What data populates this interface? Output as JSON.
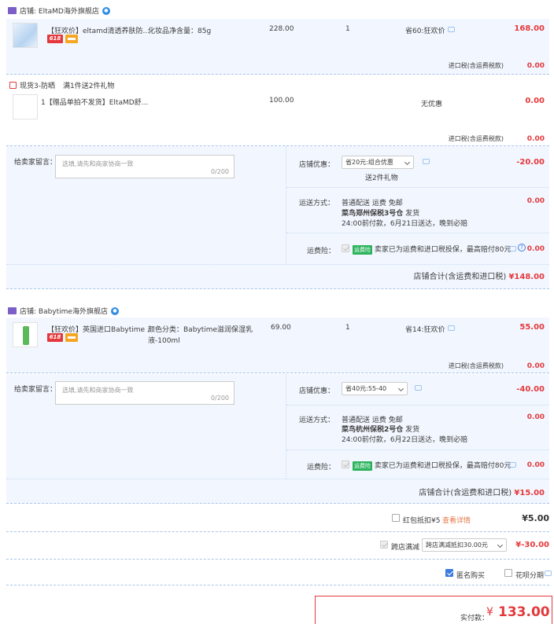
{
  "store1": {
    "name": "店铺: EltaMD海外旗舰店",
    "item": {
      "title": "【狂欢价】eltamd清透养肤防...",
      "tag618": "618",
      "sku": "化妆品净含量：85g",
      "price": "228.00",
      "qty": "1",
      "discount": "省60:狂欢价",
      "subtotal": "168.00"
    },
    "tax1": "进口税(含运费税款)",
    "tax1_val": "0.00",
    "gift_header": "现货3-防晒",
    "gift_rule": "满1件送2件礼物",
    "gift_item": {
      "title": "1【赠品单拍不发货】EltaMD舒...",
      "price": "100.00",
      "discount": "无优惠",
      "subtotal": "0.00"
    },
    "tax2": "进口税(含运费税款)",
    "tax2_val": "0.00",
    "msg_label": "给卖家留言：",
    "msg_placeholder": "选填,请先和商家协商一致",
    "msg_count": "0/200",
    "coupon_label": "店铺优惠：",
    "coupon_value": "省20元:组合优惠",
    "coupon_note": "送2件礼物",
    "coupon_amount": "-20.00",
    "ship_label": "运送方式：",
    "ship_line1": "普通配送 运费 免邮",
    "ship_line2a": "菜鸟郑州保税3号仓",
    "ship_line2b": "发货",
    "ship_line3": "24:00前付款，6月21日送达，晚到必赔",
    "ship_amount": "0.00",
    "ins_label": "运费险：",
    "ins_badge": "运费险",
    "ins_text": "卖家已为运费和进口税投保，最高赔付80元",
    "ins_amount": "0.00",
    "total_label": "店铺合计(含运费和进口税)",
    "total_value": "¥148.00"
  },
  "store2": {
    "name": "店铺: Babytime海外旗舰店",
    "item": {
      "title": "【狂欢价】英国进口Babytime ...",
      "tag618": "618",
      "sku_line1": "颜色分类：Babytime滋润保湿乳",
      "sku_line2": "液-100ml",
      "price": "69.00",
      "qty": "1",
      "discount": "省14:狂欢价",
      "subtotal": "55.00"
    },
    "tax": "进口税(含运费税款)",
    "tax_val": "0.00",
    "msg_label": "给卖家留言：",
    "msg_placeholder": "选填,请先和商家协商一致",
    "msg_count": "0/200",
    "coupon_label": "店铺优惠：",
    "coupon_value": "省40元:55-40",
    "coupon_amount": "-40.00",
    "ship_label": "运送方式：",
    "ship_line1": "普通配送 运费 免邮",
    "ship_line2a": "菜鸟杭州保税2号仓",
    "ship_line2b": "发货",
    "ship_line3": "24:00前付款，6月22日送达，晚到必赔",
    "ship_amount": "0.00",
    "ins_label": "运费险：",
    "ins_badge": "运费险",
    "ins_text": "卖家已为运费和进口税投保，最高赔付80元",
    "ins_amount": "0.00",
    "total_label": "店铺合计(含运费和进口税)",
    "total_value": "¥15.00"
  },
  "summary": {
    "redpack_label": "红包抵扣¥5",
    "redpack_link": "查看详情",
    "redpack_value": "¥5.00",
    "cross_label": "跨店满减",
    "cross_select": "跨店满减抵扣30.00元",
    "cross_value": "¥-30.00",
    "anon_label": "匿名购买",
    "huabei_label": "花呗分期",
    "pay_label": "实付款：",
    "pay_currency": "¥",
    "pay_value": "133.00"
  },
  "colors": {
    "accent_red": "#e4393c",
    "row_bg": "#f2f7ff",
    "checkbox_blue": "#3c7be0"
  }
}
